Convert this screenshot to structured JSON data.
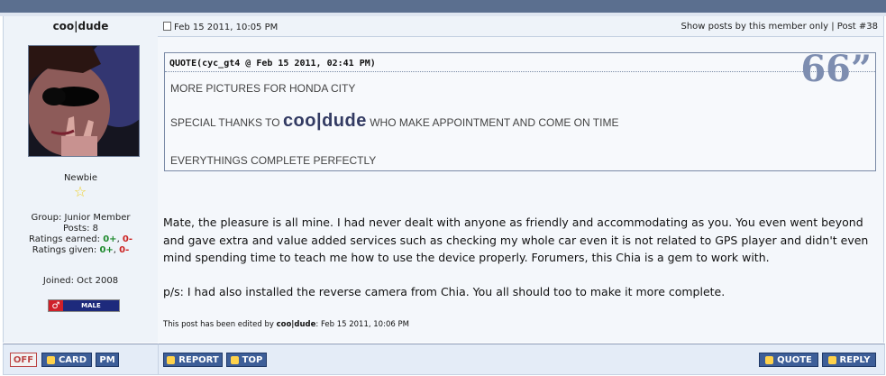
{
  "author": {
    "name": "coo|dude",
    "rank": "Newbie",
    "group": "Group: Junior Member",
    "posts": "Posts: 8",
    "ratings_earned_label": "Ratings earned:",
    "ratings_earned_pos": "0+",
    "ratings_earned_neg": "0-",
    "ratings_given_label": "Ratings given:",
    "ratings_given_pos": "0+",
    "ratings_given_neg": "0-",
    "joined": "Joined: Oct 2008",
    "gender_symbol": "♂",
    "gender_label": "MALE"
  },
  "post": {
    "date": "Feb 15 2011, 10:05 PM",
    "links": "Show posts by this member only | Post #38",
    "quote_title": "QUOTE(cyc_gt4 @ Feb 15 2011, 02:41 PM)",
    "quote_marks": "66”",
    "quote_line1": "MORE PICTURES FOR HONDA CITY",
    "quote_line2_pre": "SPECIAL THANKS TO ",
    "quote_line2_name": "coo|dude",
    "quote_line2_post": " WHO MAKE APPOINTMENT AND COME ON TIME",
    "quote_line3": "EVERYTHINGS COMPLETE PERFECTLY",
    "body": "Mate, the pleasure is all mine. I had never dealt with anyone as friendly and accommodating as you. You even went beyond and gave extra and value added services such as checking my whole car even it is not related to GPS player and didn't even mind spending time to teach me how to use the device properly. Forumers, this Chia is a gem to work with.",
    "ps": "p/s: I had also installed the reverse camera from Chia. You all should too to make it more complete.",
    "edited_pre": "This post has been edited by ",
    "edited_by": "coo|dude",
    "edited_post": ": Feb 15 2011, 10:06 PM"
  },
  "footer": {
    "off": "OFF",
    "card": "CARD",
    "pm": "PM",
    "report": "REPORT",
    "top": "TOP",
    "quote": "QUOTE",
    "reply": "REPLY"
  },
  "colors": {
    "positive": "#1f8a2e",
    "negative": "#cc2222",
    "button": "#3d5e98",
    "header_bar": "#5b6f8f"
  }
}
